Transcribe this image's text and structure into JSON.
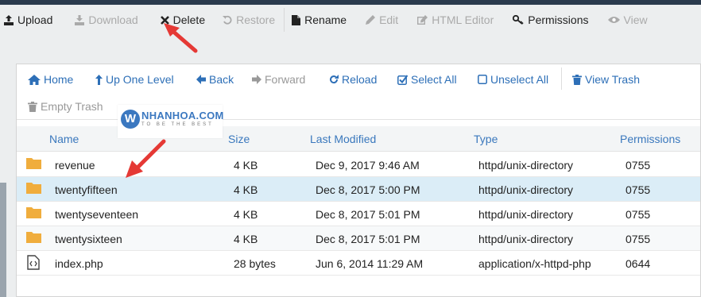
{
  "toolbar": {
    "upload": "Upload",
    "download": "Download",
    "delete": "Delete",
    "restore": "Restore",
    "rename": "Rename",
    "edit": "Edit",
    "html_editor": "HTML Editor",
    "permissions": "Permissions",
    "view": "View"
  },
  "nav": {
    "home": "Home",
    "up_one_level": "Up One Level",
    "back": "Back",
    "forward": "Forward",
    "reload": "Reload",
    "select_all": "Select All",
    "unselect_all": "Unselect All",
    "view_trash": "View Trash",
    "empty_trash": "Empty Trash"
  },
  "watermark": {
    "brand": "NHANHOA.COM",
    "tagline": "TO BE THE BEST"
  },
  "table": {
    "headers": {
      "name": "Name",
      "size": "Size",
      "last_modified": "Last Modified",
      "type": "Type",
      "permissions": "Permissions"
    },
    "rows": [
      {
        "icon": "folder-icon",
        "name": "revenue",
        "size": "4 KB",
        "modified": "Dec 9, 2017 9:46 AM",
        "type": "httpd/unix-directory",
        "perms": "0755"
      },
      {
        "icon": "folder-icon",
        "name": "twentyfifteen",
        "size": "4 KB",
        "modified": "Dec 8, 2017 5:00 PM",
        "type": "httpd/unix-directory",
        "perms": "0755"
      },
      {
        "icon": "folder-icon",
        "name": "twentyseventeen",
        "size": "4 KB",
        "modified": "Dec 8, 2017 5:01 PM",
        "type": "httpd/unix-directory",
        "perms": "0755"
      },
      {
        "icon": "folder-icon",
        "name": "twentysixteen",
        "size": "4 KB",
        "modified": "Dec 8, 2017 5:01 PM",
        "type": "httpd/unix-directory",
        "perms": "0755"
      },
      {
        "icon": "php-file-icon",
        "name": "index.php",
        "size": "28 bytes",
        "modified": "Jun 6, 2014 11:29 AM",
        "type": "application/x-httpd-php",
        "perms": "0644"
      }
    ]
  },
  "colors": {
    "link": "#2d6fb7",
    "selected_row": "#dbedf7",
    "folder": "#f0ad3d",
    "annotation_arrow": "#e53935"
  }
}
